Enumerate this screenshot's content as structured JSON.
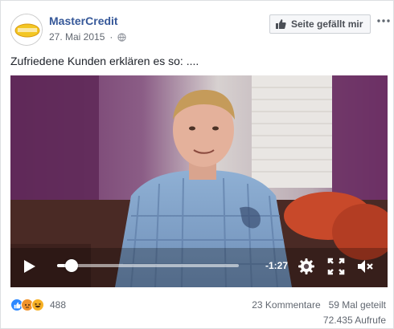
{
  "post": {
    "page_name": "MasterCredit",
    "avatar_label": "MasterCredit",
    "date": "27. Mai 2015",
    "like_page_label": "Seite gefällt mir",
    "text": "Zufriedene Kunden erklären es so: ...."
  },
  "video": {
    "time_remaining": "-1:27",
    "progress": 0.08
  },
  "footer": {
    "reaction_count": "488",
    "comments": "23 Kommentare",
    "shares": "59 Mal geteilt",
    "views": "72.435 Aufrufe"
  },
  "colors": {
    "link": "#365899",
    "like_blue": "#2d88ff",
    "angry": "#f0932b",
    "haha": "#f7b125"
  },
  "icons": {
    "globe": "globe-icon",
    "thumbs_up": "thumbs-up-icon",
    "more": "more-options-icon",
    "play": "play-icon",
    "settings": "gear-icon",
    "fullscreen": "fullscreen-icon",
    "mute": "volume-muted-icon"
  }
}
